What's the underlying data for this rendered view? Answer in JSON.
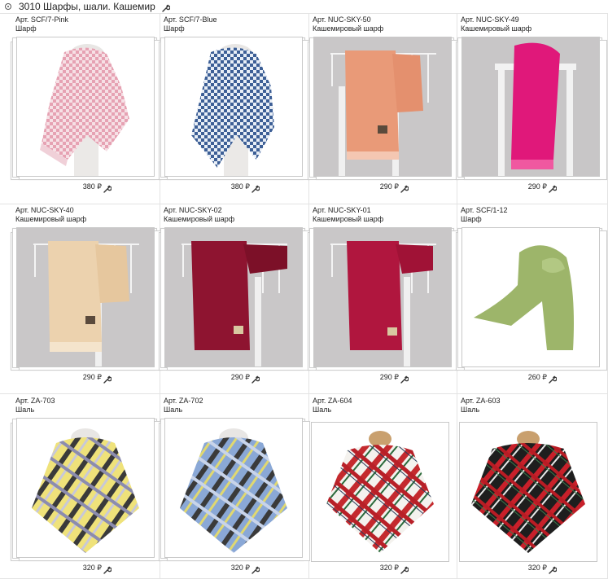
{
  "header": {
    "title": "3010 Шарфы, шали. Кашемир"
  },
  "products": [
    {
      "art": "Арт. SCF/7-Pink",
      "category": "Шарф",
      "price": "380 ₽",
      "image": "pink-houndstooth-scarf"
    },
    {
      "art": "Арт. SCF/7-Blue",
      "category": "Шарф",
      "price": "380 ₽",
      "image": "blue-houndstooth-scarf"
    },
    {
      "art": "Арт. NUC-SKY-50",
      "category": "Кашемировый шарф",
      "price": "290 ₽",
      "image": "peach-cashmere-scarf"
    },
    {
      "art": "Арт. NUC-SKY-49",
      "category": "Кашемировый шарф",
      "price": "290 ₽",
      "image": "magenta-cashmere-scarf"
    },
    {
      "art": "Арт. NUC-SKY-40",
      "category": "Кашемировый шарф",
      "price": "290 ₽",
      "image": "beige-cashmere-scarf"
    },
    {
      "art": "Арт. NUC-SKY-02",
      "category": "Кашемировый шарф",
      "price": "290 ₽",
      "image": "burgundy-cashmere-scarf"
    },
    {
      "art": "Арт. NUC-SKY-01",
      "category": "Кашемировый шарф",
      "price": "290 ₽",
      "image": "crimson-cashmere-scarf"
    },
    {
      "art": "Арт. SCF/1-12",
      "category": "Шарф",
      "price": "260 ₽",
      "image": "green-scarf"
    },
    {
      "art": "Арт. ZA-703",
      "category": "Шаль",
      "price": "320 ₽",
      "image": "yellow-plaid-shawl"
    },
    {
      "art": "Арт. ZA-702",
      "category": "Шаль",
      "price": "320 ₽",
      "image": "blue-plaid-shawl"
    },
    {
      "art": "Арт. ZA-604",
      "category": "Шаль",
      "price": "320 ₽",
      "image": "red-white-plaid-shawl"
    },
    {
      "art": "Арт. ZA-603",
      "category": "Шаль",
      "price": "320 ₽",
      "image": "black-red-plaid-shawl"
    }
  ],
  "icons": {
    "collapse": "collapse-circle-icon",
    "edit": "wrench-icon"
  },
  "colors": {
    "pink": "#e8a9b8",
    "blue": "#4a6fa5",
    "peach": "#e9a07e",
    "magenta": "#e0187a",
    "beige": "#ecd2ae",
    "burgundy": "#8e1430",
    "crimson": "#b0163e",
    "green": "#9db56a"
  }
}
